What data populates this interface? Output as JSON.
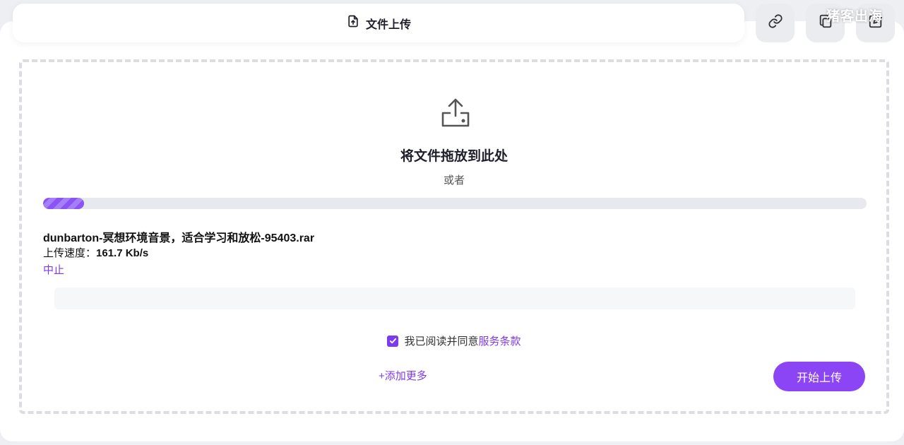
{
  "header": {
    "tab_title": "文件上传",
    "tab_icon": "file-upload-icon",
    "tool_buttons": [
      {
        "name": "link-icon"
      },
      {
        "name": "copy-icon"
      },
      {
        "name": "edit-icon"
      }
    ],
    "watermark": "猪客出海"
  },
  "dropzone": {
    "title": "将文件拖放到此处",
    "or_text": "或者"
  },
  "upload": {
    "progress": 0.05,
    "file_name": "dunbarton-冥想环境音景，适合学习和放松-95403.rar",
    "speed_label": "上传速度：",
    "speed_value": "161.7 Kb/s",
    "abort_label": "中止"
  },
  "agreement": {
    "checked": true,
    "text": "我已阅读并同意",
    "link": "服务条款"
  },
  "actions": {
    "add_more": "+添加更多",
    "start": "开始上传"
  },
  "colors": {
    "accent": "#7c3aed",
    "button": "#8b45f5"
  }
}
